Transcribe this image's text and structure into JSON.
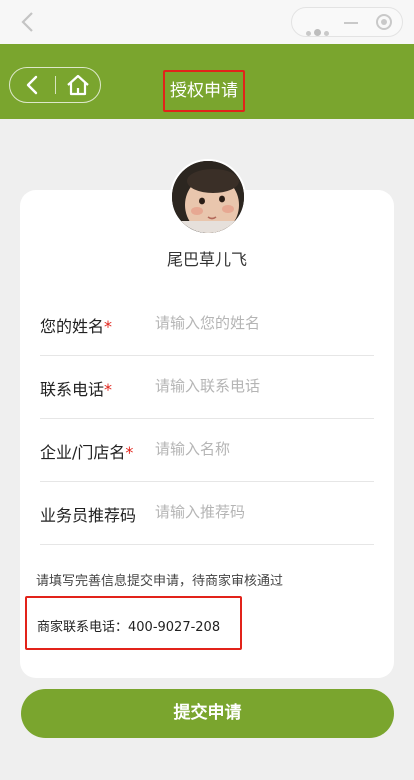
{
  "header": {
    "title": "授权申请"
  },
  "profile": {
    "name": "尾巴草儿飞"
  },
  "form": {
    "fields": [
      {
        "label": "您的姓名",
        "required": true,
        "placeholder": "请输入您的姓名",
        "value": ""
      },
      {
        "label": "联系电话",
        "required": true,
        "placeholder": "请输入联系电话",
        "value": ""
      },
      {
        "label": "企业/门店名",
        "required": true,
        "placeholder": "请输入名称",
        "value": ""
      },
      {
        "label": "业务员推荐码",
        "required": false,
        "placeholder": "请输入推荐码",
        "value": ""
      }
    ],
    "required_mark": "*",
    "notice": "请填写完善信息提交申请，待商家审核通过",
    "merchant_phone": "商家联系电话：400-9027-208"
  },
  "submit_label": "提交申请",
  "icons": [
    "back-icon",
    "more-dots-icon",
    "minimize-icon",
    "close-record-icon",
    "nav-back-icon",
    "home-icon"
  ],
  "colors": {
    "brand_green": "#7aa52e",
    "highlight_red": "#e2231a",
    "background": "#efefef"
  }
}
